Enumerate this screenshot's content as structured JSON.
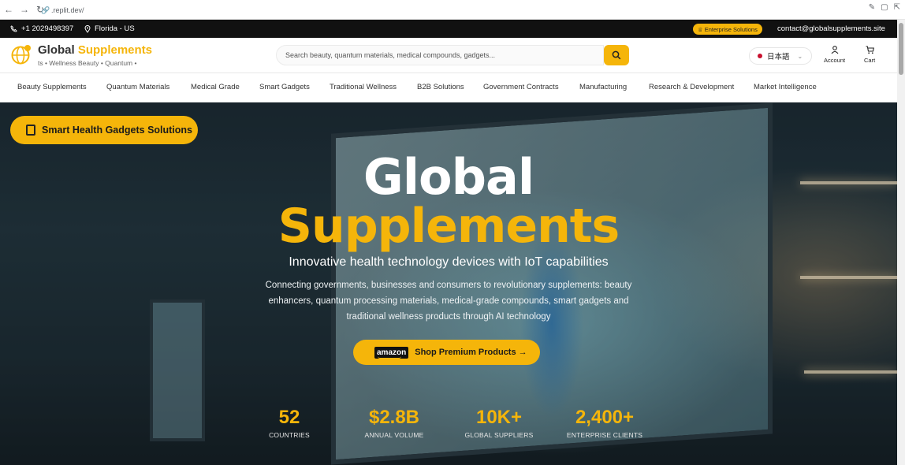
{
  "browser": {
    "url": ".replit.dev/"
  },
  "topbar": {
    "phone": "+1 2029498397",
    "location": "Florida - US",
    "enterprise_label": "Enterprise Solutions",
    "email": "contact@globalsupplements.site"
  },
  "header": {
    "brand_main": "Global",
    "brand_accent": "Supplements",
    "tagline": "ts • Wellness   Beauty • Quantum •",
    "search_placeholder": "Search beauty, quantum materials, medical compounds, gadgets...",
    "language": "日本語",
    "account_label": "Account",
    "cart_label": "Cart"
  },
  "nav": {
    "items": [
      "Beauty Supplements",
      "Quantum Materials",
      "Medical Grade",
      "Smart Gadgets",
      "Traditional Wellness",
      "B2B Solutions",
      "Government Contracts",
      "Manufacturing",
      "Research & Development",
      "Market Intelligence"
    ]
  },
  "hero": {
    "badge": "Smart Health Gadgets Solutions",
    "title_line1": "Global",
    "title_line2": "Supplements",
    "subtitle": "Innovative health technology devices with IoT capabilities",
    "description": "Connecting governments, businesses and consumers to revolutionary supplements: beauty enhancers, quantum processing materials, medical-grade compounds, smart gadgets and traditional wellness products through AI technology",
    "amazon_label": "amazon",
    "cta_label": "Shop Premium Products →",
    "stats": [
      {
        "value": "52",
        "label": "COUNTRIES"
      },
      {
        "value": "$2.8B",
        "label": "ANNUAL VOLUME"
      },
      {
        "value": "10K+",
        "label": "GLOBAL SUPPLIERS"
      },
      {
        "value": "2,400+",
        "label": "ENTERPRISE CLIENTS"
      }
    ]
  },
  "colors": {
    "accent": "#f5b50a",
    "topbar_bg": "#111111"
  }
}
